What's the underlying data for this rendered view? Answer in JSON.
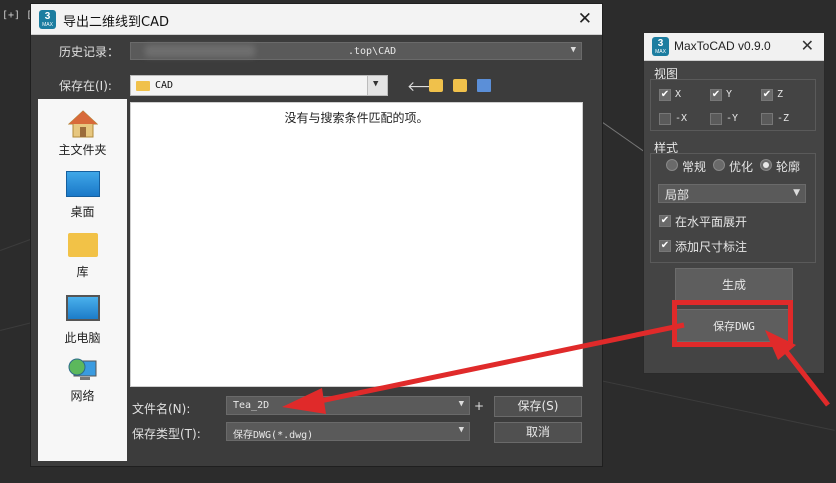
{
  "viewport": {
    "label": "[+] [透"
  },
  "dialog": {
    "title": "导出二维线到CAD",
    "close_symbol": "✕",
    "history_label": "历史记录：",
    "history_value": ".top\\CAD",
    "save_in_label": "保存在(I):",
    "save_in_value": "CAD",
    "empty_message": "没有与搜索条件匹配的项。",
    "places": [
      {
        "label": "主文件夹",
        "icon": "home-icon"
      },
      {
        "label": "桌面",
        "icon": "desktop-icon"
      },
      {
        "label": "库",
        "icon": "library-folder-icon"
      },
      {
        "label": "此电脑",
        "icon": "computer-icon"
      },
      {
        "label": "网络",
        "icon": "network-icon"
      }
    ],
    "filename_label": "文件名(N):",
    "filename_value": "Tea_2D",
    "filetype_label": "保存类型(T):",
    "filetype_value": "保存DWG(*.dwg)",
    "save_button": "保存(S)",
    "cancel_button": "取消",
    "plus_symbol": "+"
  },
  "plugin": {
    "title": "MaxToCAD v0.9.0",
    "close_symbol": "✕",
    "view_section": "视图",
    "view_options": [
      {
        "label": "X",
        "checked": true
      },
      {
        "label": "Y",
        "checked": true
      },
      {
        "label": "Z",
        "checked": true
      },
      {
        "label": "-X",
        "checked": false
      },
      {
        "label": "-Y",
        "checked": false
      },
      {
        "label": "-Z",
        "checked": false
      }
    ],
    "style_section": "样式",
    "style_options": [
      {
        "label": "常规",
        "selected": false
      },
      {
        "label": "优化",
        "selected": false
      },
      {
        "label": "轮廓",
        "selected": true
      }
    ],
    "scope_value": "局部",
    "flatten_label": "在水平面展开",
    "flatten_checked": true,
    "dimension_label": "添加尺寸标注",
    "dimension_checked": true,
    "generate_button": "生成",
    "save_dwg_button": "保存DWG"
  },
  "annotation": {
    "color": "#e02a2a"
  }
}
